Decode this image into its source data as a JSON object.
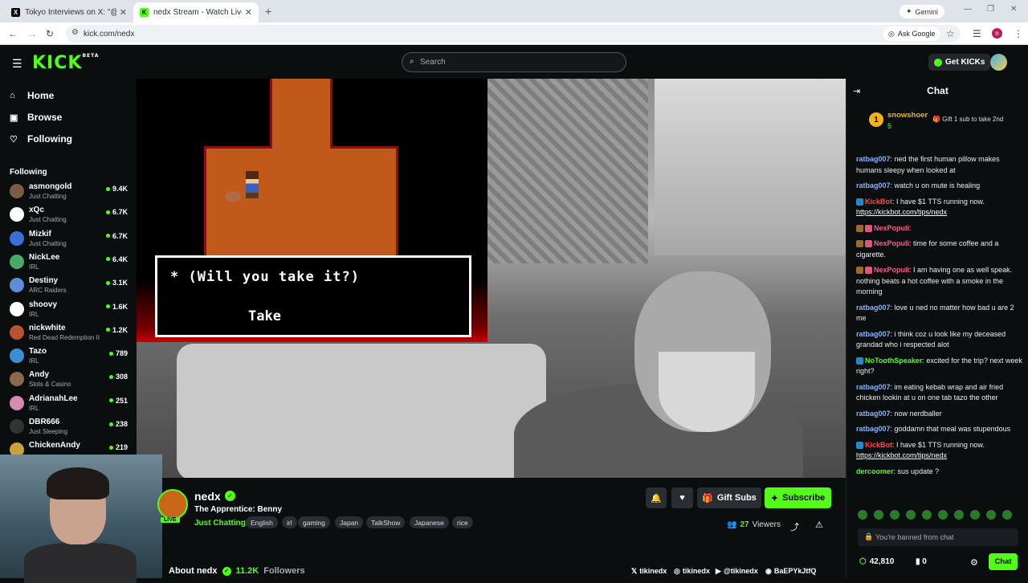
{
  "browser": {
    "tabs": [
      {
        "title": "Tokyo Interviews on X: \"@callir",
        "favicon": "X",
        "active": false
      },
      {
        "title": "nedx Stream - Watch Live on K",
        "favicon": "K",
        "active": true
      }
    ],
    "new_tab": "+",
    "gemini_label": "Gemini",
    "url": "kick.com/nedx",
    "ask_google": "Ask Google"
  },
  "kick": {
    "logo": "KICK",
    "logo_badge": "BETA",
    "search_placeholder": "Search",
    "get_kicks": "Get KICKs",
    "nav": [
      {
        "label": "Home",
        "icon": "home-icon"
      },
      {
        "label": "Browse",
        "icon": "browse-icon"
      },
      {
        "label": "Following",
        "icon": "heart-icon"
      }
    ],
    "following_heading": "Following",
    "following": [
      {
        "name": "asmongold",
        "category": "Just Chatting",
        "viewers": "9.4K",
        "color": "#7a5c44"
      },
      {
        "name": "xQc",
        "category": "Just Chatting",
        "viewers": "6.7K",
        "color": "#ffffff"
      },
      {
        "name": "Mizkif",
        "category": "Just Chatting",
        "viewers": "6.7K",
        "color": "#3b6fd6"
      },
      {
        "name": "NickLee",
        "category": "IRL",
        "viewers": "6.4K",
        "color": "#4aa86b"
      },
      {
        "name": "Destiny",
        "category": "ARC Raiders",
        "viewers": "3.1K",
        "color": "#5b8ed6"
      },
      {
        "name": "shoovy",
        "category": "IRL",
        "viewers": "1.6K",
        "color": "#ffffff"
      },
      {
        "name": "nickwhite",
        "category": "Red Dead Redemption II",
        "viewers": "1.2K",
        "color": "#b5542f"
      },
      {
        "name": "Tazo",
        "category": "IRL",
        "viewers": "789",
        "color": "#3b8ed6"
      },
      {
        "name": "Andy",
        "category": "Slots & Casino",
        "viewers": "308",
        "color": "#8a6a4a"
      },
      {
        "name": "AdrianahLee",
        "category": "IRL",
        "viewers": "251",
        "color": "#d68ab0"
      },
      {
        "name": "DBR666",
        "category": "Just Sleeping",
        "viewers": "238",
        "color": "#333333"
      },
      {
        "name": "ChickenAndy",
        "category": "",
        "viewers": "219",
        "color": "#c9a33a"
      }
    ],
    "game": {
      "dialog_text": "* (Will you take it?)",
      "dialog_option": "Take"
    },
    "stream": {
      "channel": "nedx",
      "live_badge": "LIVE",
      "title": "The Apprentice: Benny",
      "category": "Just Chatting",
      "tags": [
        "English",
        "irl",
        "gaming",
        "Japan",
        "TalkShow",
        "Japanese",
        "rice"
      ],
      "gift_subs": "Gift Subs",
      "subscribe": "Subscribe",
      "viewers_count": "27",
      "viewers_label": "Viewers",
      "about_label": "About nedx",
      "followers_count": "11.2K",
      "followers_label": "Followers",
      "socials": [
        {
          "label": "tikinedx",
          "icon": "x-icon"
        },
        {
          "label": "tikinedx",
          "icon": "instagram-icon"
        },
        {
          "label": "@tikinedx",
          "icon": "youtube-icon"
        },
        {
          "label": "BaEPYkJtfQ",
          "icon": "discord-icon"
        }
      ]
    },
    "chat": {
      "title": "Chat",
      "pinned": {
        "rank": "1",
        "user": "snowshoer",
        "count": "5",
        "gift_text": "Gift 1 sub to take 2nd"
      },
      "messages": [
        {
          "user": "ratbag007",
          "color": "#8ab4f8",
          "text": "ned the first human pillow makes humans sleepy when looked at",
          "link": ""
        },
        {
          "user": "ratbag007",
          "color": "#8ab4f8",
          "text": "watch u on mute is healing",
          "link": ""
        },
        {
          "user": "KickBot",
          "color": "#ff4a4a",
          "text": "I have $1 TTS running now.",
          "link": "https://kickbot.com/tips/nedx"
        },
        {
          "user": "NexPopuli",
          "color": "#ff5a8a",
          "text": "",
          "link": ""
        },
        {
          "user": "NexPopuli",
          "color": "#ff5a8a",
          "text": "time for some coffee and a cigarette.",
          "link": ""
        },
        {
          "user": "NexPopuli",
          "color": "#ff5a8a",
          "text": "I am having one as well speak. nothing beats a hot coffee with a smoke in the morning",
          "link": ""
        },
        {
          "user": "ratbag007",
          "color": "#8ab4f8",
          "text": "love u ned no matter how bad u are 2 me",
          "link": ""
        },
        {
          "user": "ratbag007",
          "color": "#8ab4f8",
          "text": "i think coz u look like my deceased grandad who i respected alot",
          "link": ""
        },
        {
          "user": "NoToothSpeaker",
          "color": "#53fc18",
          "text": "excited for the trip? next week right?",
          "link": ""
        },
        {
          "user": "ratbag007",
          "color": "#8ab4f8",
          "text": "im eating kebab wrap and air fried chicken lookin at u on one tab tazo the other",
          "link": ""
        },
        {
          "user": "ratbag007",
          "color": "#8ab4f8",
          "text": "now nerdballer",
          "link": ""
        },
        {
          "user": "ratbag007",
          "color": "#8ab4f8",
          "text": "goddamn that meal was stupendous",
          "link": ""
        },
        {
          "user": "KickBot",
          "color": "#ff4a4a",
          "text": "I have $1 TTS running now.",
          "link": "https://kickbot.com/tips/nedx"
        },
        {
          "user": "dercoomer",
          "color": "#53fc18",
          "text": "sus update ?",
          "link": ""
        }
      ],
      "banned_text": "You're banned from chat",
      "kicks_balance": "42,810",
      "points": "0",
      "chat_button": "Chat"
    }
  }
}
